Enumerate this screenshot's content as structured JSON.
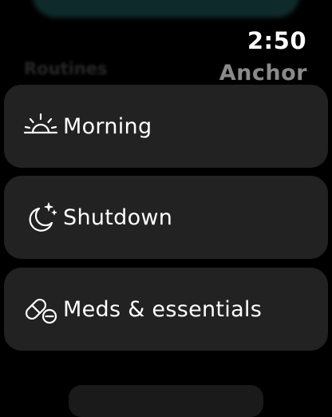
{
  "status": {
    "time": "2:50"
  },
  "app": {
    "title": "Anchor"
  },
  "section": {
    "title": "Routines"
  },
  "routines": [
    {
      "label": "Morning",
      "icon": "sunrise-icon"
    },
    {
      "label": "Shutdown",
      "icon": "moon-stars-icon"
    },
    {
      "label": "Meds & essentials",
      "icon": "pills-icon"
    }
  ],
  "colors": {
    "background": "#000000",
    "card": "#222222",
    "title_gray": "#8a8a8a",
    "text": "#ffffff"
  }
}
